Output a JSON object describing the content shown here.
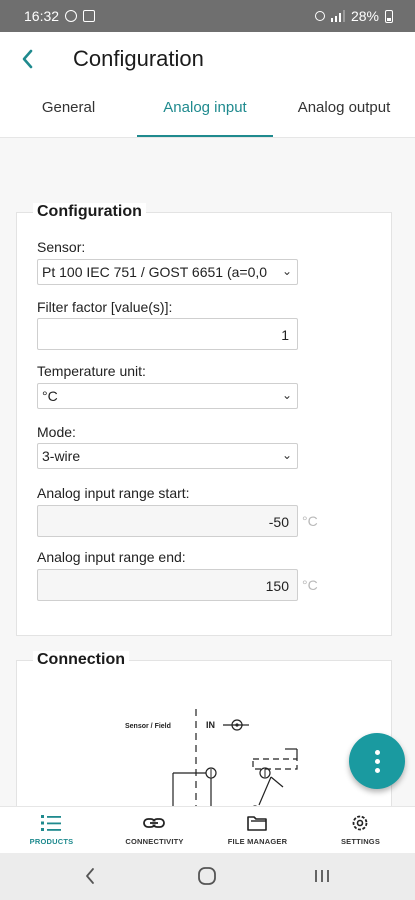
{
  "status_bar": {
    "time": "16:32",
    "battery": "28%",
    "left_icons": [
      "whatsapp-icon",
      "image-icon"
    ],
    "right_icons": [
      "alarm-icon",
      "signal-icon",
      "battery-icon"
    ]
  },
  "header": {
    "title": "Configuration",
    "back_icon": "chevron-left-icon"
  },
  "tabs": [
    {
      "label": "General",
      "active": false
    },
    {
      "label": "Analog input",
      "active": true
    },
    {
      "label": "Analog output",
      "active": false
    }
  ],
  "colors": {
    "accent": "#1f8a8e",
    "fab": "#1a9aa0",
    "status_bar": "#6f6f6f"
  },
  "configuration": {
    "title": "Configuration",
    "sensor": {
      "label": "Sensor:",
      "value": "Pt 100 IEC 751 / GOST 6651 (a=0,0"
    },
    "filter_factor": {
      "label": "Filter factor [value(s)]:",
      "value": "1"
    },
    "temperature_unit": {
      "label": "Temperature unit:",
      "value": "°C"
    },
    "mode": {
      "label": "Mode:",
      "value": "3-wire"
    },
    "range_start": {
      "label": "Analog input range start:",
      "value": "-50",
      "unit": "°C"
    },
    "range_end": {
      "label": "Analog input range end:",
      "value": "150",
      "unit": "°C"
    }
  },
  "connection": {
    "title": "Connection",
    "diagram_labels": {
      "sensor_field": "Sensor / Field",
      "in": "IN"
    }
  },
  "fab": {
    "icon": "more-vertical-icon"
  },
  "bottom_nav": [
    {
      "label": "PRODUCTS",
      "icon": "list-icon",
      "active": true
    },
    {
      "label": "CONNECTIVITY",
      "icon": "link-icon",
      "active": false
    },
    {
      "label": "FILE MANAGER",
      "icon": "folder-icon",
      "active": false
    },
    {
      "label": "SETTINGS",
      "icon": "gear-icon",
      "active": false
    }
  ],
  "system_nav": [
    "recents-icon",
    "home-icon",
    "back-icon"
  ]
}
